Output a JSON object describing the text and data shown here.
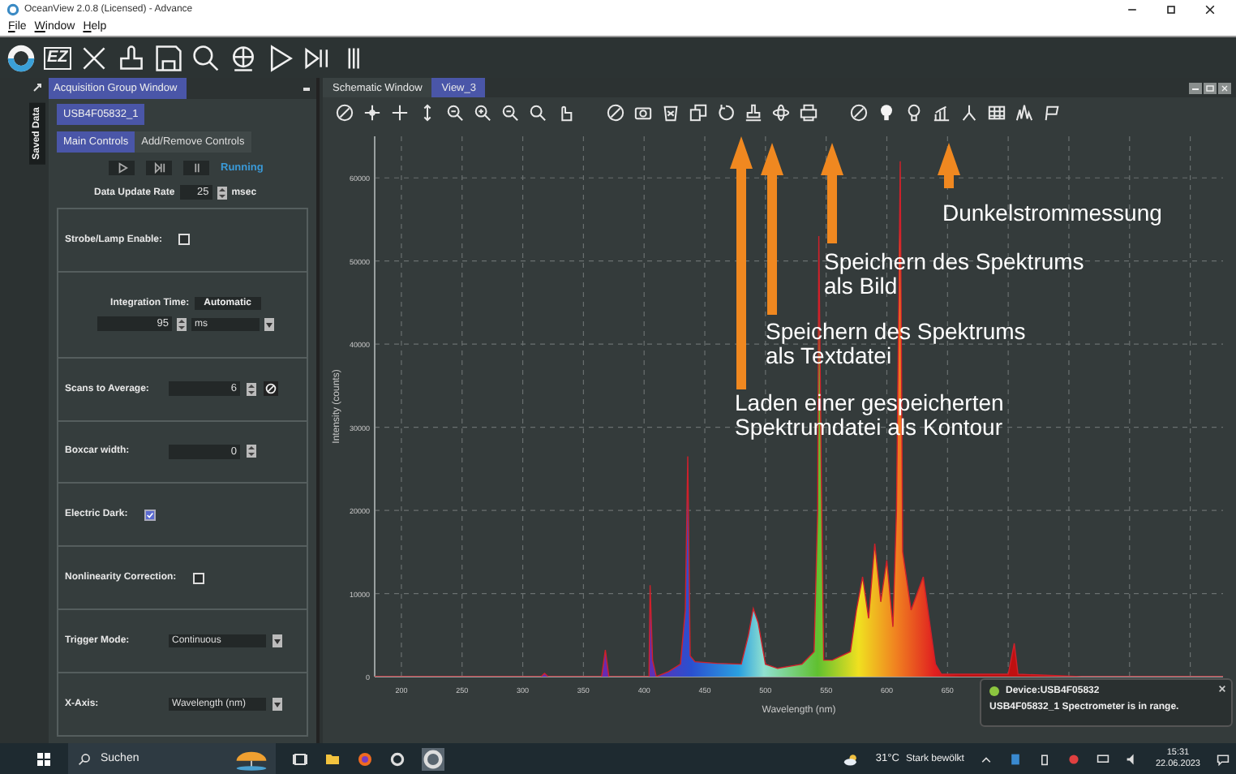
{
  "window": {
    "title": "OceanView 2.0.8 (Licensed) - Advance"
  },
  "menu": [
    "File",
    "Window",
    "Help"
  ],
  "toolbar": {
    "ez_label": "EZ"
  },
  "side_tab": "Saved Data",
  "acquisition": {
    "title": "Acquisition Group Window",
    "device": "USB4F05832_1",
    "tabs": [
      {
        "label": "Main Controls",
        "selected": true
      },
      {
        "label": "Add/Remove Controls",
        "selected": false
      }
    ],
    "status": "Running",
    "update_label": "Data Update Rate",
    "update_value": "25",
    "update_unit": "msec"
  },
  "controls": [
    {
      "kind": "checkbox",
      "label": "Strobe/Lamp Enable:",
      "checked": false
    },
    {
      "kind": "integration",
      "label": "Integration Time:",
      "mode": "Automatic",
      "value": "95",
      "unit": "ms"
    },
    {
      "kind": "spinner_reset",
      "label": "Scans to Average:",
      "value": "6"
    },
    {
      "kind": "spinner",
      "label": "Boxcar width:",
      "value": "0"
    },
    {
      "kind": "checkbox",
      "label": "Electric Dark:",
      "checked": true
    },
    {
      "kind": "checkbox",
      "label": "Nonlinearity Correction:",
      "checked": false
    },
    {
      "kind": "select",
      "label": "Trigger Mode:",
      "value": "Continuous"
    },
    {
      "kind": "select",
      "label": "X-Axis:",
      "value": "Wavelength (nm)"
    }
  ],
  "view": {
    "tabs": [
      {
        "label": "Schematic Window",
        "selected": false
      },
      {
        "label": "View_3",
        "selected": true
      }
    ]
  },
  "chart_data": {
    "type": "area",
    "xlabel": "Wavelength (nm)",
    "ylabel": "Intensity (counts)",
    "x": [
      178,
      300,
      315,
      318,
      321,
      360,
      365,
      368,
      371,
      400,
      404,
      405,
      407,
      410,
      420,
      430,
      434,
      436,
      438,
      442,
      460,
      480,
      486,
      490,
      494,
      500,
      510,
      530,
      540,
      543,
      544,
      546,
      548,
      555,
      570,
      575,
      580,
      585,
      590,
      595,
      600,
      605,
      608,
      611,
      613,
      620,
      630,
      640,
      645,
      660,
      700,
      705,
      708,
      760,
      877
    ],
    "grid": true,
    "series": [
      {
        "color": "#d0202a",
        "values": [
          0,
          0,
          0,
          400,
          0,
          0,
          0,
          3200,
          0,
          0,
          0,
          11000,
          2000,
          0,
          600,
          1500,
          8000,
          26500,
          2500,
          1800,
          1600,
          1500,
          5000,
          8200,
          6500,
          1500,
          1000,
          1500,
          3000,
          20000,
          53000,
          25000,
          2000,
          2000,
          3000,
          8000,
          12000,
          7000,
          16000,
          9000,
          14000,
          6000,
          20000,
          62000,
          15000,
          8000,
          12000,
          1500,
          300,
          300,
          300,
          4000,
          300,
          0,
          0
        ]
      }
    ],
    "xlim": [
      178,
      877
    ],
    "ylim": [
      0,
      65000
    ],
    "xticks": [
      200,
      250,
      300,
      350,
      400,
      450,
      500,
      550,
      600,
      650
    ],
    "yticks": [
      0,
      10000,
      20000,
      30000,
      40000,
      50000,
      60000
    ],
    "annotations": [
      "Laden einer gespeicherten\nSpektrumdatei als Kontour",
      "Speichern des Spektrums\nals Textdatei",
      "Speichern des Spektrums\nals Bild",
      "Dunkelstrommessung"
    ]
  },
  "notification": {
    "title": "Device:USB4F05832",
    "message": "USB4F05832_1 Spectrometer is in range."
  },
  "taskbar": {
    "search": "Suchen",
    "temperature": "31°C",
    "weather": "Stark bewölkt",
    "time": "15:31",
    "date": "22.06.2023"
  }
}
